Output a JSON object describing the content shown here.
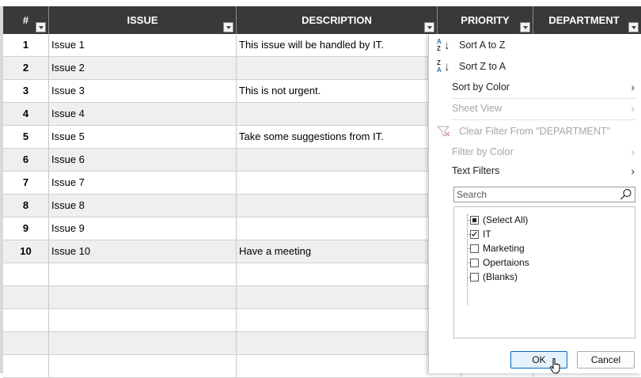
{
  "columns": [
    {
      "label": "#",
      "left": 0
    },
    {
      "label": "ISSUE"
    },
    {
      "label": "DESCRIPTION"
    },
    {
      "label": "PRIORITY"
    },
    {
      "label": "DEPARTMENT"
    }
  ],
  "rows": [
    {
      "num": "1",
      "issue": "Issue 1",
      "description": "This issue will be handled by IT."
    },
    {
      "num": "2",
      "issue": "Issue 2",
      "description": ""
    },
    {
      "num": "3",
      "issue": "Issue 3",
      "description": "This is not urgent."
    },
    {
      "num": "4",
      "issue": "Issue 4",
      "description": ""
    },
    {
      "num": "5",
      "issue": "Issue 5",
      "description": "Take some suggestions from IT."
    },
    {
      "num": "6",
      "issue": "Issue 6",
      "description": ""
    },
    {
      "num": "7",
      "issue": "Issue 7",
      "description": ""
    },
    {
      "num": "8",
      "issue": "Issue 8",
      "description": ""
    },
    {
      "num": "9",
      "issue": "Issue 9",
      "description": ""
    },
    {
      "num": "10",
      "issue": "Issue 10",
      "description": "Have a meeting"
    },
    {
      "num": "",
      "issue": "",
      "description": ""
    },
    {
      "num": "",
      "issue": "",
      "description": ""
    },
    {
      "num": "",
      "issue": "",
      "description": ""
    },
    {
      "num": "",
      "issue": "",
      "description": ""
    },
    {
      "num": "",
      "issue": "",
      "description": ""
    }
  ],
  "filter_menu": {
    "sort_a_to_z": "Sort A to Z",
    "sort_z_to_a": "Sort Z to A",
    "sort_by_color": "Sort by Color",
    "sheet_view": "Sheet View",
    "clear_filter": "Clear Filter From \"DEPARTMENT\"",
    "filter_by_color": "Filter by Color",
    "text_filters": "Text Filters",
    "search_placeholder": "Search",
    "items": [
      {
        "label": "(Select All)",
        "state": "partial"
      },
      {
        "label": "IT",
        "state": "checked"
      },
      {
        "label": "Marketing",
        "state": "unchecked"
      },
      {
        "label": "Opertaions",
        "state": "unchecked"
      },
      {
        "label": "(Blanks)",
        "state": "unchecked"
      }
    ],
    "ok_label": "OK",
    "cancel_label": "Cancel"
  },
  "colors": {
    "header_bg": "#3a3838",
    "header_text": "#ffffff",
    "band": "#efefef",
    "accent": "#0067c0"
  }
}
